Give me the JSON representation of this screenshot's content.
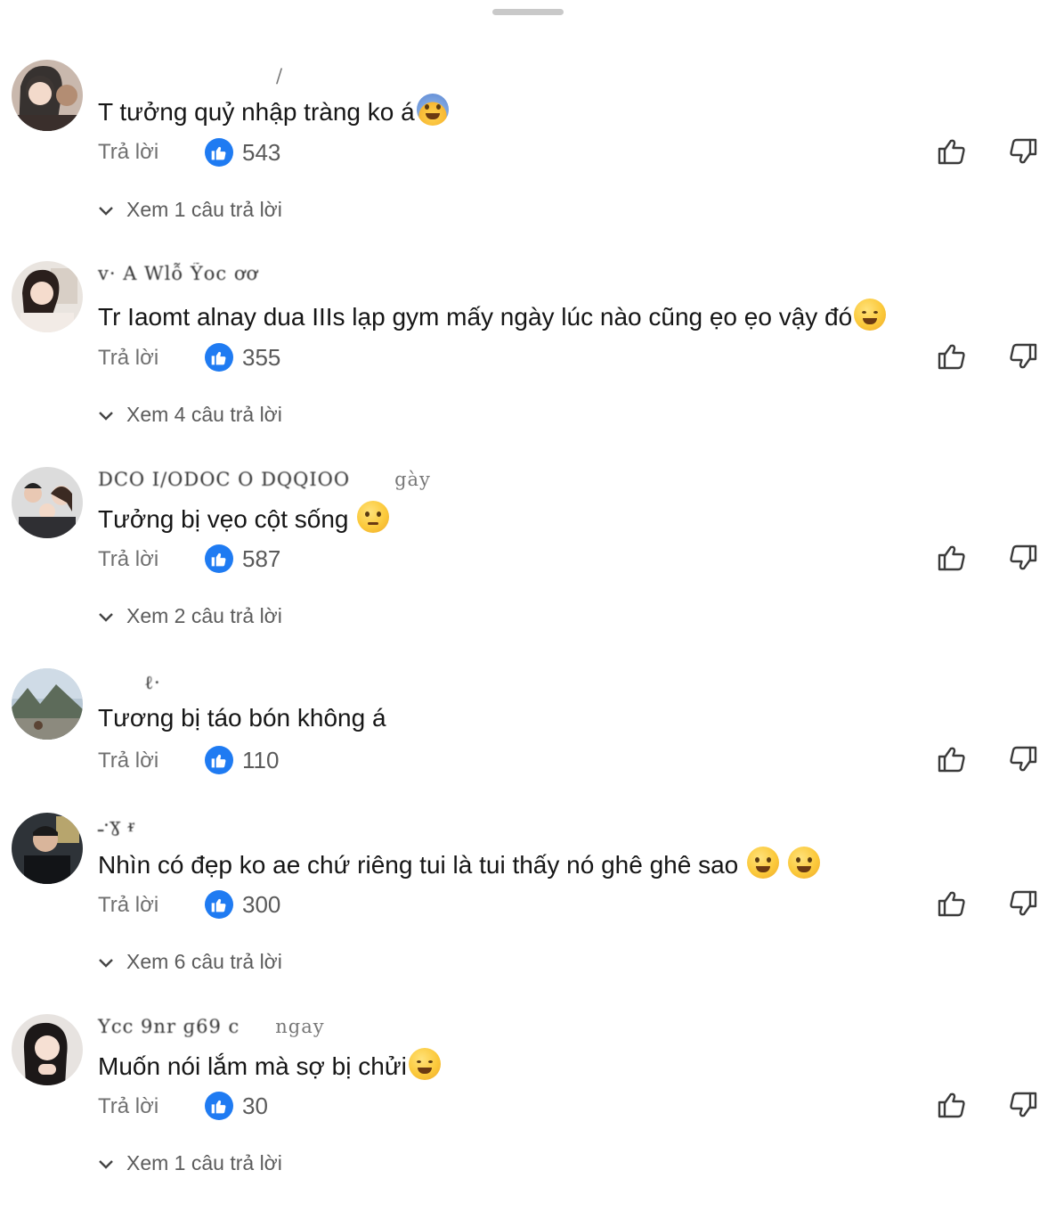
{
  "comments": [
    {
      "username": "",
      "username_suffix": "/",
      "text": "T tưởng quỷ nhập tràng ko á",
      "emoji": "fearful-face",
      "reply_label": "Trả lời",
      "likes": "543",
      "view_replies": "Xem 1 câu trả lời"
    },
    {
      "username": "v· A Wlỗ Ỹoc   ơơ",
      "username_suffix": "",
      "text": "Tr Iaomt alnay dua IIIs lạp gym mấy ngày lúc nào cũng ẹo ẹo vậy đó",
      "emoji": "tears-of-joy",
      "reply_label": "Trả lời",
      "likes": "355",
      "view_replies": "Xem 4 câu trả lời"
    },
    {
      "username": "DCO I/ODOC O DQQIOO",
      "username_suffix": "gày",
      "text": "Tưởng bị vẹo cột sống",
      "emoji": "thinking-face",
      "reply_label": "Trả lời",
      "likes": "587",
      "view_replies": "Xem 2 câu trả lời"
    },
    {
      "username": "ℓ·",
      "username_suffix": "",
      "text": "Tương bị táo bón không á",
      "emoji": "",
      "reply_label": "Trả lời",
      "likes": "110",
      "view_replies": ""
    },
    {
      "username": "ـ·ɣ  ᵲ",
      "username_suffix": "",
      "text": "Nhìn có đẹp ko ae chứ riêng tui là tui thấy nó ghê ghê sao",
      "emoji": "grinning-squinting-face x2",
      "reply_label": "Trả lời",
      "likes": "300",
      "view_replies": "Xem 6 câu trả lời"
    },
    {
      "username": "Ycc 9nr ɡ69 c",
      "username_suffix": "ngay",
      "text": "Muốn nói lắm mà sợ bị chửi",
      "emoji": "tears-of-joy",
      "reply_label": "Trả lời",
      "likes": "30",
      "view_replies": "Xem 1 câu trả lời"
    }
  ],
  "icons": {
    "like_badge": "thumbs-up-icon",
    "like_action": "thumbs-up-outline-icon",
    "dislike_action": "thumbs-down-outline-icon",
    "expand": "chevron-down-icon"
  },
  "colors": {
    "like_badge": "#1f7bf2",
    "muted_text": "#707070",
    "text": "#161616"
  }
}
